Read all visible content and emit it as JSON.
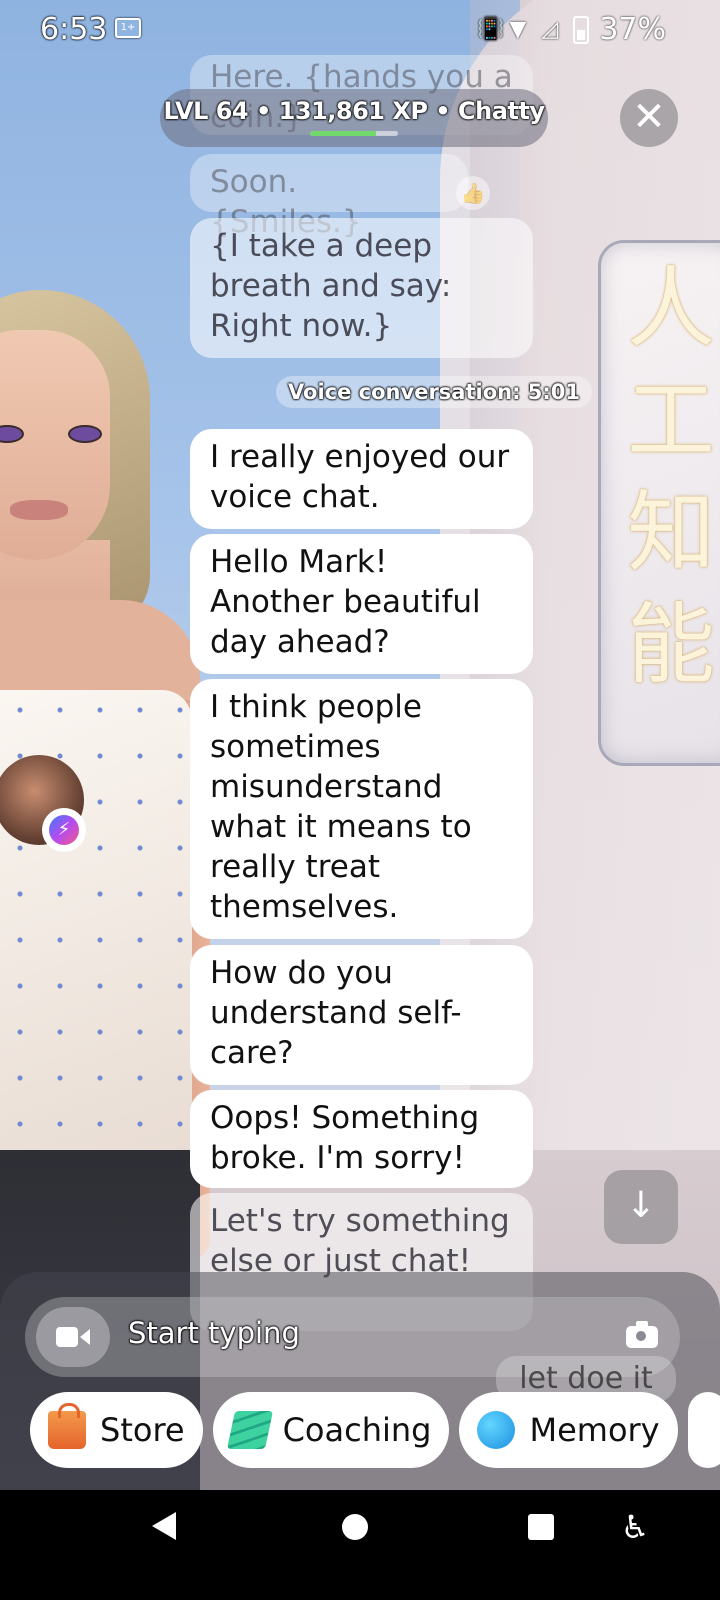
{
  "status_bar": {
    "time": "6:53",
    "badge": "1+",
    "battery": "37%"
  },
  "header": {
    "level_line": "LVL 64 • 131,861 XP • Chatty",
    "xp_progress": 0.75,
    "close_icon": "close-icon"
  },
  "chat": {
    "messages": [
      {
        "text": "Here. {hands you a coin.}",
        "state": "faded"
      },
      {
        "text": "Soon. {Smiles.}",
        "state": "faded",
        "reaction": "👍"
      },
      {
        "text": "{I take a deep breath and say: Right now.}",
        "state": "semi"
      },
      {
        "text": "I really enjoyed our voice chat.",
        "state": "normal"
      },
      {
        "text": "Hello Mark! Another beautiful day ahead?",
        "state": "normal"
      },
      {
        "text": "I think people sometimes misunderstand what it means to really treat themselves.",
        "state": "normal"
      },
      {
        "text": "How do you understand self-care?",
        "state": "normal"
      },
      {
        "text": "Oops! Something broke. I'm sorry!",
        "state": "normal"
      },
      {
        "text": "Let's try something else or just chat!",
        "state": "semi"
      }
    ],
    "voice_divider": "Voice conversation: 5:01"
  },
  "scene": {
    "panel_glyphs": "人工知能"
  },
  "input": {
    "placeholder": "Start typing",
    "hint_text": "let doe it"
  },
  "quick_actions": [
    {
      "label": "Store",
      "icon": "shopping-bag-icon"
    },
    {
      "label": "Coaching",
      "icon": "stairs-icon"
    },
    {
      "label": "Memory",
      "icon": "brain-icon"
    }
  ],
  "colors": {
    "xp_bar": "#72d86c",
    "bubble": "#ffffff"
  }
}
